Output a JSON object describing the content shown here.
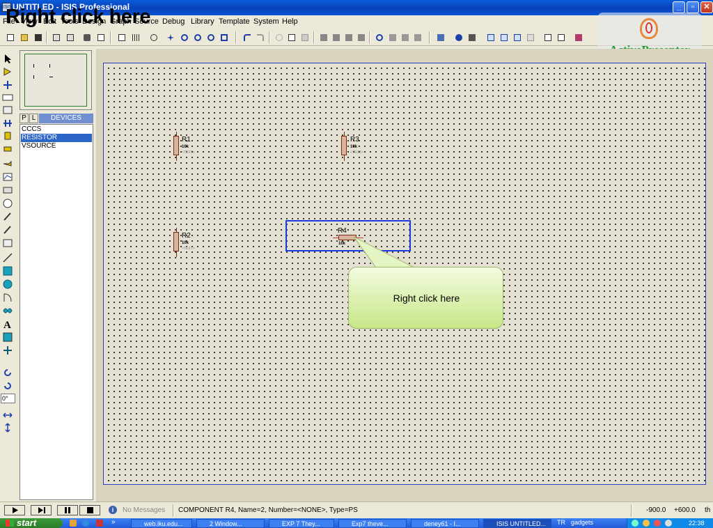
{
  "window": {
    "title": "UNTITLED - ISIS Professional",
    "app_icon": "ISIS",
    "overlay_caption": "Right click here"
  },
  "menu": [
    "File",
    "View",
    "Edit",
    "Tools",
    "Design",
    "Graph",
    "Source",
    "Debug",
    "Library",
    "Template",
    "System",
    "Help"
  ],
  "watermark": {
    "brand": "ActivePresenter"
  },
  "side_panel": {
    "tab_p": "P",
    "tab_l": "L",
    "header": "DEVICES",
    "devices": [
      "CCCS",
      "RESISTOR",
      "VSOURCE"
    ],
    "selected_device": "RESISTOR"
  },
  "rotation_field": {
    "value": "0°"
  },
  "components": [
    {
      "ref": "R1",
      "value": "10k",
      "text": "<TEXT>"
    },
    {
      "ref": "R2",
      "value": "10k",
      "text": "<TEXT>"
    },
    {
      "ref": "R3",
      "value": "10k",
      "text": "<TEXT>"
    },
    {
      "ref": "R4",
      "value": "10k",
      "text": "<TEXT>"
    }
  ],
  "callout": {
    "text": "Right click here"
  },
  "status": {
    "messages": "No Messages",
    "info": "COMPONENT R4, Name=2, Number=<NONE>, Type=PS",
    "coord_x": "-900.0",
    "coord_y": "+600.0",
    "units": "th"
  },
  "taskbar": {
    "start": "start",
    "tasks": [
      "web.iku.edu...",
      "2 Window...",
      "EXP 7 They...",
      "Exp7 theve...",
      "deney61 - I...",
      "ISIS UNTITLED..."
    ],
    "tray_lang": "TR",
    "tray_item": "gadgets",
    "clock": "22:38"
  }
}
